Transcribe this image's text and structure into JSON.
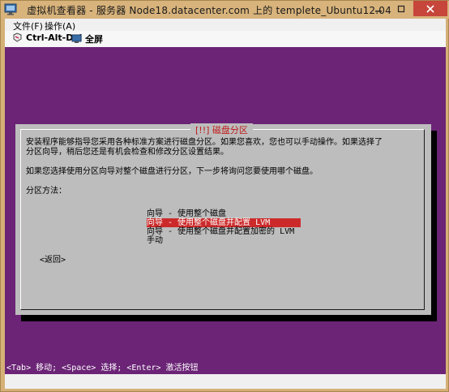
{
  "window": {
    "title": "虚拟机查看器 - 服务器 Node18.datacenter.com 上的 templete_Ubuntu12.04",
    "accent": "#d5b077",
    "close_color": "#c7463c"
  },
  "menubar": {
    "items": [
      {
        "label": "文件(F)"
      },
      {
        "label": "操作(A)"
      }
    ]
  },
  "toolbar": {
    "ctrl_alt_del_label": "Ctrl-Alt-Del",
    "fullscreen_label": "全屏"
  },
  "console": {
    "background": "#6b2476",
    "dialog": {
      "title": "[!!] 磁盘分区",
      "lines": [
        "安装程序能够指导您采用各种标准方案进行磁盘分区。如果您喜欢，您也可以手动操作。如果选择了",
        "分区向导，稍后您还是有机会检查和修改分区设置结果。",
        "",
        "如果您选择使用分区向导对整个磁盘进行分区，下一步将询问您要使用哪个磁盘。",
        "",
        "分区方法："
      ],
      "options": [
        {
          "label": "向导 - 使用整个磁盘",
          "selected": false
        },
        {
          "label": "向导 - 使用整个磁盘并配置 LVM",
          "selected": true
        },
        {
          "label": "向导 - 使用整个磁盘并配置加密的 LVM",
          "selected": false
        },
        {
          "label": "手动",
          "selected": false
        }
      ],
      "back_label": "<返回>",
      "highlight_color": "#cc2a2a"
    },
    "status_text": "<Tab> 移动; <Space> 选择; <Enter> 激活按钮"
  }
}
